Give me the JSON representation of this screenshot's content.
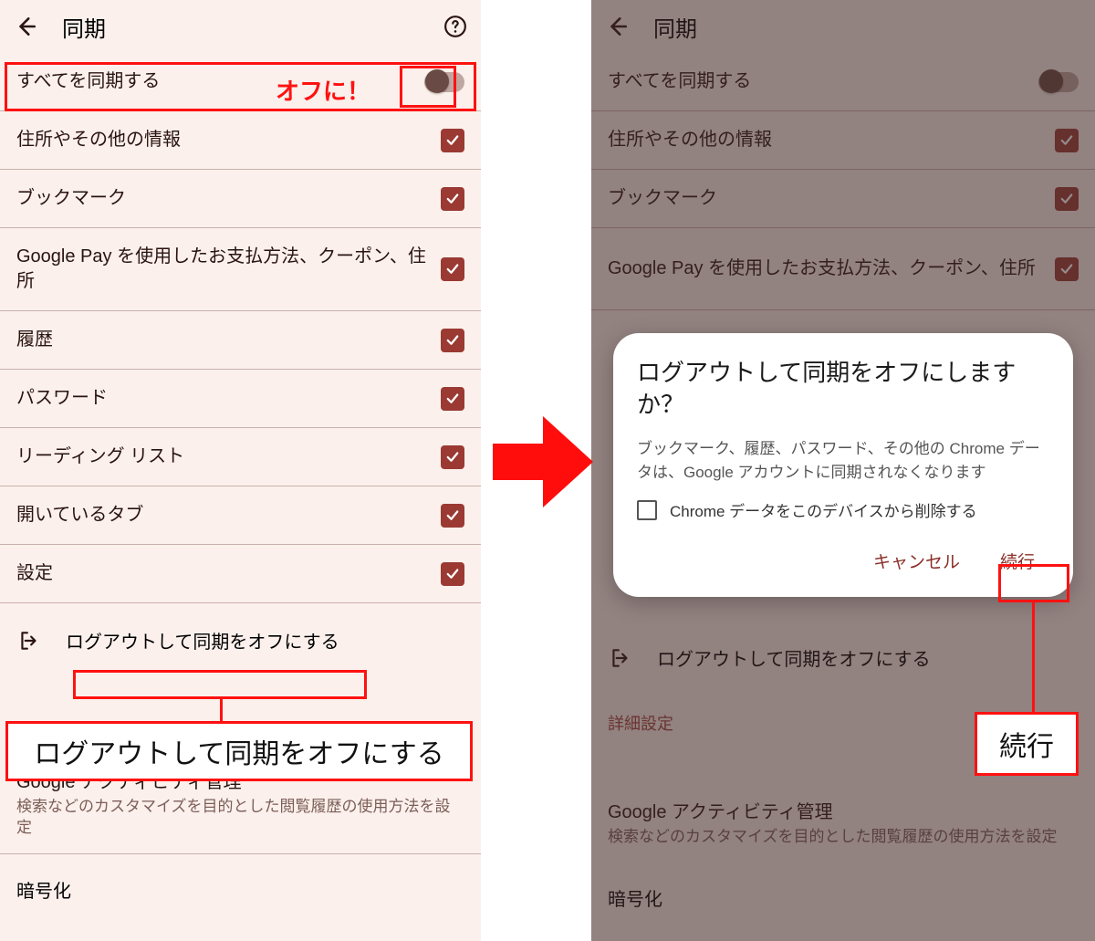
{
  "annotations": {
    "off_label": "オフに！",
    "logout_callout": "ログアウトして同期をオフにする",
    "continue_callout": "続行"
  },
  "left": {
    "header": {
      "title": "同期"
    },
    "sync_all": {
      "label": "すべてを同期する"
    },
    "items": [
      {
        "label": "住所やその他の情報"
      },
      {
        "label": "ブックマーク"
      },
      {
        "label": "Google Pay を使用したお支払方法、クーポン、住所"
      },
      {
        "label": "履歴"
      },
      {
        "label": "パスワード"
      },
      {
        "label": "リーディング リスト"
      },
      {
        "label": "開いているタブ"
      },
      {
        "label": "設定"
      }
    ],
    "signout": {
      "label": "ログアウトして同期をオフにする"
    },
    "activity": {
      "title": "Google アクティビティ管理",
      "sub": "検索などのカスタマイズを目的とした閲覧履歴の使用方法を設定"
    },
    "encrypt": {
      "label": "暗号化"
    }
  },
  "right": {
    "header": {
      "title": "同期"
    },
    "sync_all": {
      "label": "すべてを同期する"
    },
    "items": [
      {
        "label": "住所やその他の情報"
      },
      {
        "label": "ブックマーク"
      },
      {
        "label": "Google Pay を使用したお支払方法、クーポン、住所"
      }
    ],
    "signout": {
      "label": "ログアウトして同期をオフにする"
    },
    "advanced_label": "詳細設定",
    "activity": {
      "title": "Google アクティビティ管理",
      "sub": "検索などのカスタマイズを目的とした閲覧履歴の使用方法を設定"
    },
    "encrypt": {
      "label": "暗号化"
    },
    "dialog": {
      "title": "ログアウトして同期をオフにしますか？",
      "message": "ブックマーク、履歴、パスワード、その他の Chrome データは、Google アカウントに同期されなくなります",
      "checkbox": "Chrome データをこのデバイスから削除する",
      "cancel": "キャンセル",
      "continue": "続行"
    }
  }
}
